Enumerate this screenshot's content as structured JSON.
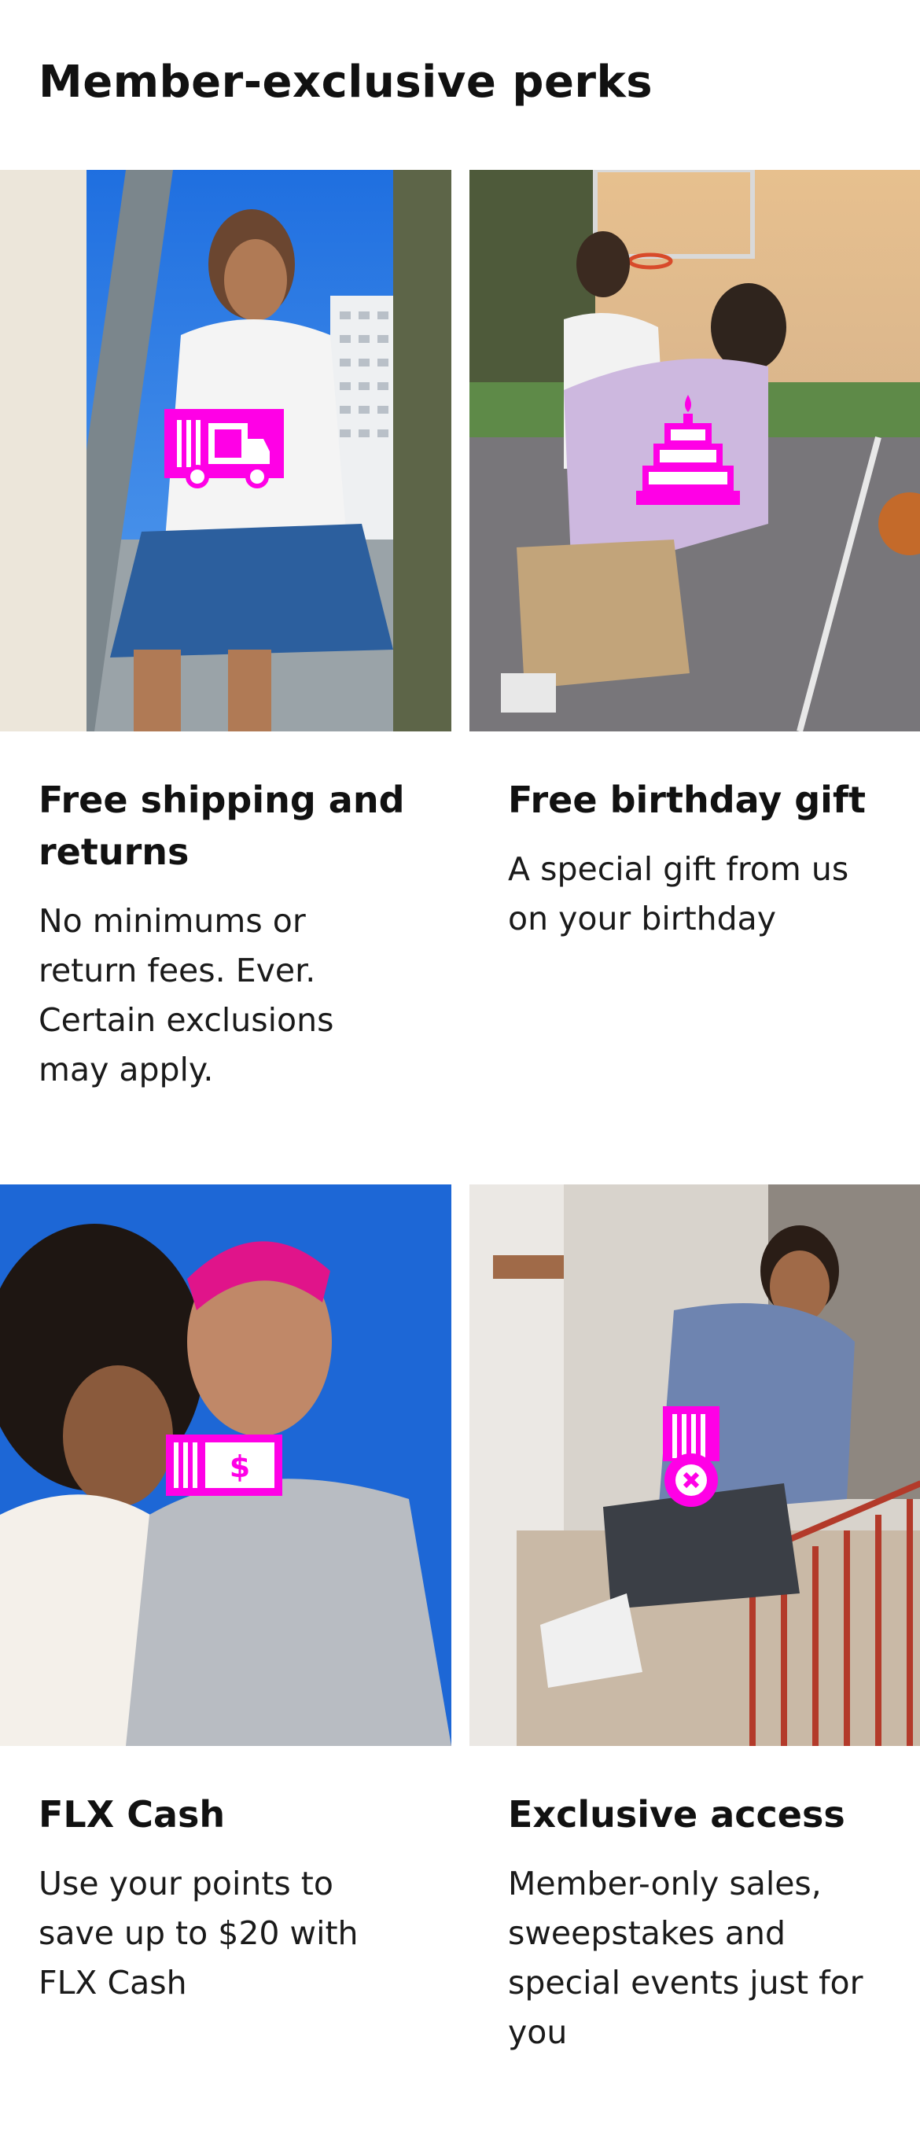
{
  "page": {
    "title": "Member-exclusive perks"
  },
  "perks": [
    {
      "title": "Free shipping and returns",
      "description": "No minimums or return fees. Ever. Certain exclusions may apply.",
      "icon": "truck-icon"
    },
    {
      "title": "Free birthday gift",
      "description": "A special gift from us on your birthday",
      "icon": "cake-icon"
    },
    {
      "title": "FLX Cash",
      "description": "Use your points to save up to $20 with FLX Cash",
      "icon": "dollar-bill-icon"
    },
    {
      "title": "Exclusive access",
      "description": "Member-only sales, sweepstakes and special events just for you",
      "icon": "ticket-medal-icon"
    }
  ],
  "theme": {
    "accent": "#ff00e6",
    "text": "#111111"
  }
}
